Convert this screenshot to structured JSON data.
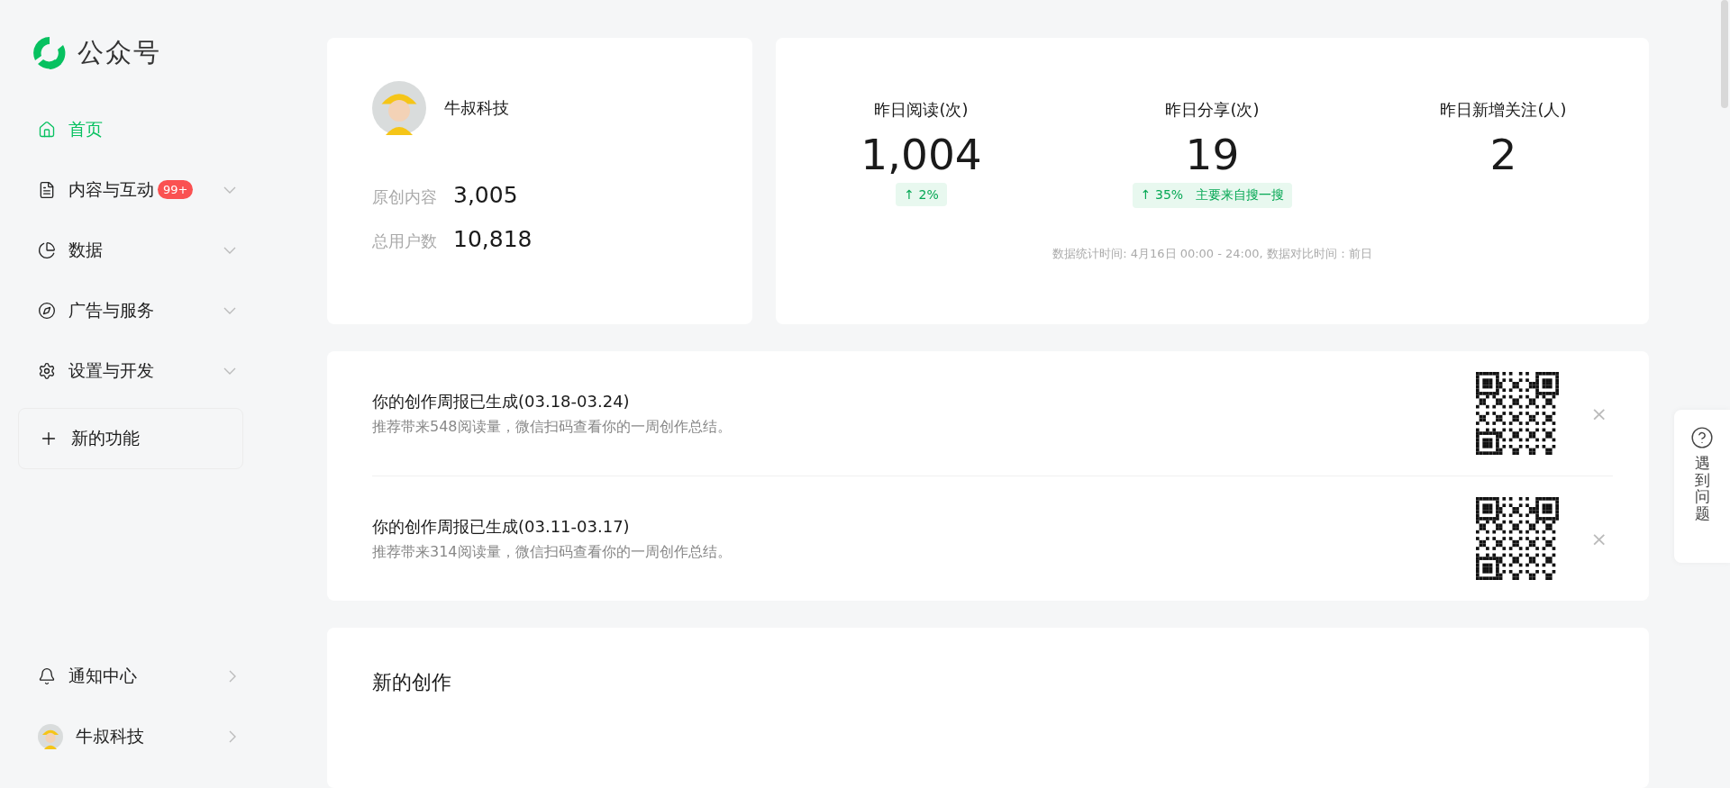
{
  "brand": {
    "name": "公众号"
  },
  "nav": [
    {
      "label": "首页",
      "kind": "page",
      "selected": true
    },
    {
      "label": "内容与互动",
      "kind": "group",
      "selected": false,
      "badge": "99+"
    },
    {
      "label": "数据",
      "kind": "group",
      "selected": false
    },
    {
      "label": "广告与服务",
      "kind": "group",
      "selected": false
    },
    {
      "label": "设置与开发",
      "kind": "group",
      "selected": false
    }
  ],
  "new_feature": {
    "label": "新的功能"
  },
  "footer_nav": [
    {
      "label": "通知中心"
    },
    {
      "label": "牛叔科技"
    }
  ],
  "account": {
    "name": "牛叔科技",
    "stats": [
      {
        "label": "原创内容",
        "value": "3,005"
      },
      {
        "label": "总用户数",
        "value": "10,818"
      }
    ]
  },
  "yesterday": {
    "metrics": [
      {
        "label": "昨日阅读(次)",
        "value": "1,004",
        "trend": "↑ 2%"
      },
      {
        "label": "昨日分享(次)",
        "value": "19",
        "trend": "↑ 35%",
        "source": "主要来自搜一搜"
      },
      {
        "label": "昨日新增关注(人)",
        "value": "2"
      }
    ],
    "note": "数据统计时间: 4月16日 00:00 - 24:00, 数据对比时间：前日"
  },
  "reports": [
    {
      "title": "你的创作周报已生成(03.18-03.24)",
      "desc": "推荐带来548阅读量，微信扫码查看你的一周创作总结。",
      "close": "×"
    },
    {
      "title": "你的创作周报已生成(03.11-03.17)",
      "desc": "推荐带来314阅读量，微信扫码查看你的一周创作总结。",
      "close": "×"
    }
  ],
  "new_creation": {
    "title": "新的创作"
  },
  "help": {
    "label": "遇到问题"
  }
}
